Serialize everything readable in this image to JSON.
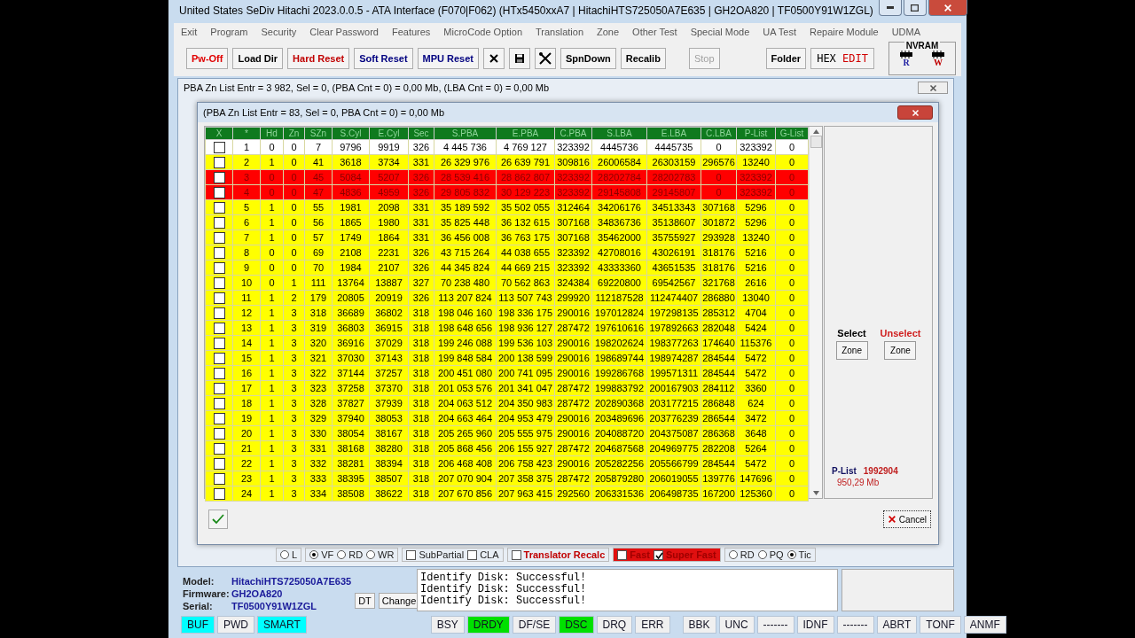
{
  "window": {
    "title": "United States  SeDiv Hitachi  2023.0.0.5 - ATA Interface  (F070|F062) (HTx5450xxA7 | HitachiHTS725050A7E635 | GH2OA820 | TF0500Y91W1ZGL)"
  },
  "menu": [
    "Exit",
    "Program",
    "Security",
    "Clear Password",
    "Features",
    "MicroCode Option",
    "Translation",
    "Zone",
    "Other Test",
    "Special Mode",
    "UA Test",
    "Repaire Module",
    "UDMA"
  ],
  "toolbar": [
    {
      "kind": "text",
      "label": "Pw-Off",
      "color": "#e00000",
      "disabled": false
    },
    {
      "kind": "text",
      "label": "Load Dir",
      "color": "#000000",
      "disabled": false
    },
    {
      "kind": "text",
      "label": "Hard Reset",
      "color": "#c00000",
      "disabled": false
    },
    {
      "kind": "text",
      "label": "Soft Reset",
      "color": "#000080",
      "disabled": false
    },
    {
      "kind": "text",
      "label": "MPU Reset",
      "color": "#000080",
      "disabled": false
    },
    {
      "kind": "cross"
    },
    {
      "kind": "disk"
    },
    {
      "kind": "tools"
    },
    {
      "kind": "text",
      "label": "SpnDown",
      "color": "#000000",
      "disabled": false
    },
    {
      "kind": "text",
      "label": "Recalib",
      "color": "#000000",
      "disabled": false
    },
    {
      "kind": "text",
      "label": "Stop",
      "color": "#a0a0a0",
      "disabled": true
    },
    {
      "kind": "text",
      "label": "Folder",
      "color": "#000000",
      "disabled": false
    },
    {
      "kind": "hex",
      "parts": [
        "HEX",
        "EDIT"
      ]
    }
  ],
  "nvram": {
    "title": "NVRAM",
    "read": "R",
    "write": "W"
  },
  "outer_dialog": {
    "title": "PBA Zn List Entr = 3 982, Sel = 0, (PBA Cnt = 0) = 0,00 Mb, (LBA Cnt = 0) = 0,00 Mb"
  },
  "inner_dialog": {
    "title": "(PBA Zn List Entr = 83, Sel = 0, PBA Cnt = 0) = 0,00 Mb"
  },
  "table": {
    "checkbox_column": "X",
    "columns": [
      "*",
      "Hd",
      "Zn",
      "SZn",
      "S.Cyl",
      "E.Cyl",
      "Sec",
      "S.PBA",
      "E.PBA",
      "C.PBA",
      "S.LBA",
      "E.LBA",
      "C.LBA",
      "P-List",
      "G-List"
    ],
    "rows": [
      {
        "checked": false,
        "color": "#ffffff",
        "cells": [
          "1",
          "0",
          "0",
          "7",
          "9796",
          "9919",
          "326",
          "4 445 736",
          "4 769 127",
          "323392",
          "4445736",
          "4445735",
          "0",
          "323392",
          "0"
        ]
      },
      {
        "checked": false,
        "color": "#ffff00",
        "cells": [
          "2",
          "1",
          "0",
          "41",
          "3618",
          "3734",
          "331",
          "26 329 976",
          "26 639 791",
          "309816",
          "26006584",
          "26303159",
          "296576",
          "13240",
          "0"
        ]
      },
      {
        "checked": false,
        "color": "#ff0000",
        "cells": [
          "3",
          "0",
          "0",
          "45",
          "5084",
          "5207",
          "326",
          "28 539 416",
          "28 862 807",
          "323392",
          "28202784",
          "28202783",
          "0",
          "323392",
          "0"
        ]
      },
      {
        "checked": false,
        "color": "#ff0000",
        "cells": [
          "4",
          "0",
          "0",
          "47",
          "4836",
          "4959",
          "326",
          "29 805 832",
          "30 129 223",
          "323392",
          "29145808",
          "29145807",
          "0",
          "323392",
          "0"
        ]
      },
      {
        "checked": false,
        "color": "#ffff00",
        "cells": [
          "5",
          "1",
          "0",
          "55",
          "1981",
          "2098",
          "331",
          "35 189 592",
          "35 502 055",
          "312464",
          "34206176",
          "34513343",
          "307168",
          "5296",
          "0"
        ]
      },
      {
        "checked": false,
        "color": "#ffff00",
        "cells": [
          "6",
          "1",
          "0",
          "56",
          "1865",
          "1980",
          "331",
          "35 825 448",
          "36 132 615",
          "307168",
          "34836736",
          "35138607",
          "301872",
          "5296",
          "0"
        ]
      },
      {
        "checked": false,
        "color": "#ffff00",
        "cells": [
          "7",
          "1",
          "0",
          "57",
          "1749",
          "1864",
          "331",
          "36 456 008",
          "36 763 175",
          "307168",
          "35462000",
          "35755927",
          "293928",
          "13240",
          "0"
        ]
      },
      {
        "checked": false,
        "color": "#ffff00",
        "cells": [
          "8",
          "0",
          "0",
          "69",
          "2108",
          "2231",
          "326",
          "43 715 264",
          "44 038 655",
          "323392",
          "42708016",
          "43026191",
          "318176",
          "5216",
          "0"
        ]
      },
      {
        "checked": false,
        "color": "#ffff00",
        "cells": [
          "9",
          "0",
          "0",
          "70",
          "1984",
          "2107",
          "326",
          "44 345 824",
          "44 669 215",
          "323392",
          "43333360",
          "43651535",
          "318176",
          "5216",
          "0"
        ]
      },
      {
        "checked": false,
        "color": "#ffff00",
        "cells": [
          "10",
          "0",
          "1",
          "111",
          "13764",
          "13887",
          "327",
          "70 238 480",
          "70 562 863",
          "324384",
          "69220800",
          "69542567",
          "321768",
          "2616",
          "0"
        ]
      },
      {
        "checked": false,
        "color": "#ffff00",
        "cells": [
          "11",
          "1",
          "2",
          "179",
          "20805",
          "20919",
          "326",
          "113 207 824",
          "113 507 743",
          "299920",
          "112187528",
          "112474407",
          "286880",
          "13040",
          "0"
        ]
      },
      {
        "checked": false,
        "color": "#ffff00",
        "cells": [
          "12",
          "1",
          "3",
          "318",
          "36689",
          "36802",
          "318",
          "198 046 160",
          "198 336 175",
          "290016",
          "197012824",
          "197298135",
          "285312",
          "4704",
          "0"
        ]
      },
      {
        "checked": false,
        "color": "#ffff00",
        "cells": [
          "13",
          "1",
          "3",
          "319",
          "36803",
          "36915",
          "318",
          "198 648 656",
          "198 936 127",
          "287472",
          "197610616",
          "197892663",
          "282048",
          "5424",
          "0"
        ]
      },
      {
        "checked": false,
        "color": "#ffff00",
        "cells": [
          "14",
          "1",
          "3",
          "320",
          "36916",
          "37029",
          "318",
          "199 246 088",
          "199 536 103",
          "290016",
          "198202624",
          "198377263",
          "174640",
          "115376",
          "0"
        ]
      },
      {
        "checked": false,
        "color": "#ffff00",
        "cells": [
          "15",
          "1",
          "3",
          "321",
          "37030",
          "37143",
          "318",
          "199 848 584",
          "200 138 599",
          "290016",
          "198689744",
          "198974287",
          "284544",
          "5472",
          "0"
        ]
      },
      {
        "checked": false,
        "color": "#ffff00",
        "cells": [
          "16",
          "1",
          "3",
          "322",
          "37144",
          "37257",
          "318",
          "200 451 080",
          "200 741 095",
          "290016",
          "199286768",
          "199571311",
          "284544",
          "5472",
          "0"
        ]
      },
      {
        "checked": false,
        "color": "#ffff00",
        "cells": [
          "17",
          "1",
          "3",
          "323",
          "37258",
          "37370",
          "318",
          "201 053 576",
          "201 341 047",
          "287472",
          "199883792",
          "200167903",
          "284112",
          "3360",
          "0"
        ]
      },
      {
        "checked": false,
        "color": "#ffff00",
        "cells": [
          "18",
          "1",
          "3",
          "328",
          "37827",
          "37939",
          "318",
          "204 063 512",
          "204 350 983",
          "287472",
          "202890368",
          "203177215",
          "286848",
          "624",
          "0"
        ]
      },
      {
        "checked": false,
        "color": "#ffff00",
        "cells": [
          "19",
          "1",
          "3",
          "329",
          "37940",
          "38053",
          "318",
          "204 663 464",
          "204 953 479",
          "290016",
          "203489696",
          "203776239",
          "286544",
          "3472",
          "0"
        ]
      },
      {
        "checked": false,
        "color": "#ffff00",
        "cells": [
          "20",
          "1",
          "3",
          "330",
          "38054",
          "38167",
          "318",
          "205 265 960",
          "205 555 975",
          "290016",
          "204088720",
          "204375087",
          "286368",
          "3648",
          "0"
        ]
      },
      {
        "checked": false,
        "color": "#ffff00",
        "cells": [
          "21",
          "1",
          "3",
          "331",
          "38168",
          "38280",
          "318",
          "205 868 456",
          "206 155 927",
          "287472",
          "204687568",
          "204969775",
          "282208",
          "5264",
          "0"
        ]
      },
      {
        "checked": false,
        "color": "#ffff00",
        "cells": [
          "22",
          "1",
          "3",
          "332",
          "38281",
          "38394",
          "318",
          "206 468 408",
          "206 758 423",
          "290016",
          "205282256",
          "205566799",
          "284544",
          "5472",
          "0"
        ]
      },
      {
        "checked": false,
        "color": "#ffff00",
        "cells": [
          "23",
          "1",
          "3",
          "333",
          "38395",
          "38507",
          "318",
          "207 070 904",
          "207 358 375",
          "287472",
          "205879280",
          "206019055",
          "139776",
          "147696",
          "0"
        ]
      },
      {
        "checked": false,
        "color": "#ffff00",
        "cells": [
          "24",
          "1",
          "3",
          "334",
          "38508",
          "38622",
          "318",
          "207 670 856",
          "207 963 415",
          "292560",
          "206331536",
          "206498735",
          "167200",
          "125360",
          "0"
        ]
      }
    ]
  },
  "zone_select": {
    "select_label": "Select",
    "unselect_label": "Unselect",
    "select_button": "Zone",
    "unselect_button": "Zone"
  },
  "plist": {
    "label": "P-List",
    "value": "1992904",
    "size": "950,29 Mb"
  },
  "cancel": "Cancel",
  "options": [
    {
      "kind": "radio",
      "items": [
        {
          "label": "L",
          "selected": false
        }
      ]
    },
    {
      "kind": "radio",
      "items": [
        {
          "label": "VF",
          "selected": true
        },
        {
          "label": "RD",
          "selected": false
        },
        {
          "label": "WR",
          "selected": false
        }
      ]
    },
    {
      "kind": "check",
      "items": [
        {
          "label": "SubPartial",
          "checked": false
        },
        {
          "label": "CLA",
          "checked": false
        }
      ]
    },
    {
      "kind": "warning",
      "items": [
        {
          "label": "Translator Recalc",
          "checked": false
        }
      ]
    },
    {
      "kind": "highlight",
      "items": [
        {
          "label": "Fast",
          "checked": false
        },
        {
          "label": "Super Fast",
          "checked": true
        }
      ]
    },
    {
      "kind": "radio",
      "items": [
        {
          "label": "RD",
          "selected": false
        },
        {
          "label": "PQ",
          "selected": false
        },
        {
          "label": "Tic",
          "selected": true
        }
      ]
    }
  ],
  "drive": [
    {
      "label": "Model:",
      "value": "HitachiHTS725050A7E635"
    },
    {
      "label": "Firmware:",
      "value": "GH2OA820"
    },
    {
      "label": "Serial:",
      "value": "TF0500Y91W1ZGL"
    }
  ],
  "drive_buttons": [
    "DT",
    "Change"
  ],
  "log": [
    "Identify Disk: Successful!",
    "Identify Disk: Successful!",
    "Identify Disk: Successful!"
  ],
  "status": [
    [
      {
        "label": "BUF",
        "color": "#00ffff"
      },
      {
        "label": "PWD",
        "color": "#f0f0f0"
      },
      {
        "label": "SMART",
        "color": "#00ffff"
      }
    ],
    [
      {
        "label": "BSY",
        "color": "#f0f0f0"
      },
      {
        "label": "DRDY",
        "color": "#00e000"
      },
      {
        "label": "DF/SE",
        "color": "#f0f0f0"
      },
      {
        "label": "DSC",
        "color": "#00e000"
      },
      {
        "label": "DRQ",
        "color": "#f0f0f0"
      },
      {
        "label": "ERR",
        "color": "#f0f0f0"
      }
    ],
    [
      {
        "label": "BBK",
        "color": "#f0f0f0"
      },
      {
        "label": "UNC",
        "color": "#f0f0f0"
      },
      {
        "label": "-------",
        "color": "#f0f0f0"
      },
      {
        "label": "IDNF",
        "color": "#f0f0f0"
      },
      {
        "label": "-------",
        "color": "#f0f0f0"
      },
      {
        "label": "ABRT",
        "color": "#f0f0f0"
      },
      {
        "label": "TONF",
        "color": "#f0f0f0"
      },
      {
        "label": "ANMF",
        "color": "#f0f0f0"
      }
    ]
  ]
}
